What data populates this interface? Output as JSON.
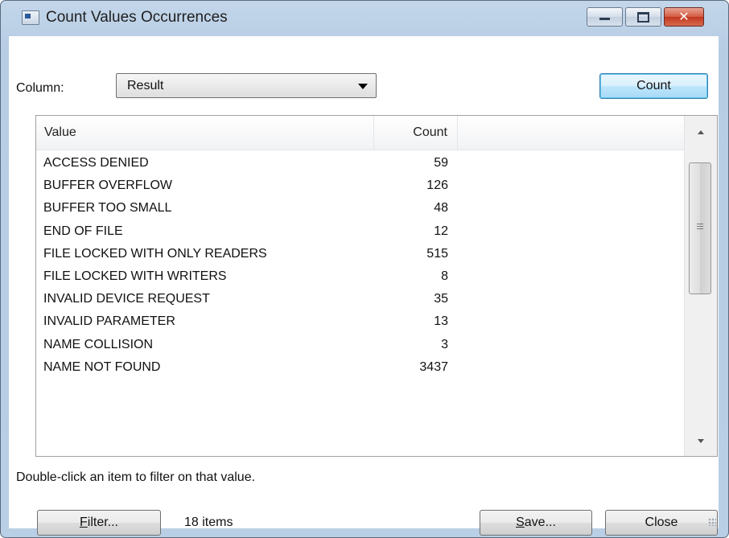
{
  "window": {
    "title": "Count Values Occurrences",
    "controls": {
      "minimize": "minimize",
      "maximize": "maximize",
      "close": "✕"
    }
  },
  "column_select": {
    "label": "Column:",
    "selected": "Result"
  },
  "count_button": "Count",
  "list": {
    "headers": {
      "value": "Value",
      "count": "Count"
    },
    "rows": [
      {
        "value": "ACCESS DENIED",
        "count": "59"
      },
      {
        "value": "BUFFER OVERFLOW",
        "count": "126"
      },
      {
        "value": "BUFFER TOO SMALL",
        "count": "48"
      },
      {
        "value": "END OF FILE",
        "count": "12"
      },
      {
        "value": "FILE LOCKED WITH ONLY READERS",
        "count": "515"
      },
      {
        "value": "FILE LOCKED WITH WRITERS",
        "count": "8"
      },
      {
        "value": "INVALID DEVICE REQUEST",
        "count": "35"
      },
      {
        "value": "INVALID PARAMETER",
        "count": "13"
      },
      {
        "value": "NAME COLLISION",
        "count": "3"
      },
      {
        "value": "NAME NOT FOUND",
        "count": "3437"
      }
    ]
  },
  "hint": "Double-click an item to filter on that value.",
  "filter_button": {
    "mnemonic": "F",
    "rest": "ilter..."
  },
  "item_count": "18 items",
  "save_button": {
    "mnemonic": "S",
    "rest": "ave..."
  },
  "close_button": "Close"
}
